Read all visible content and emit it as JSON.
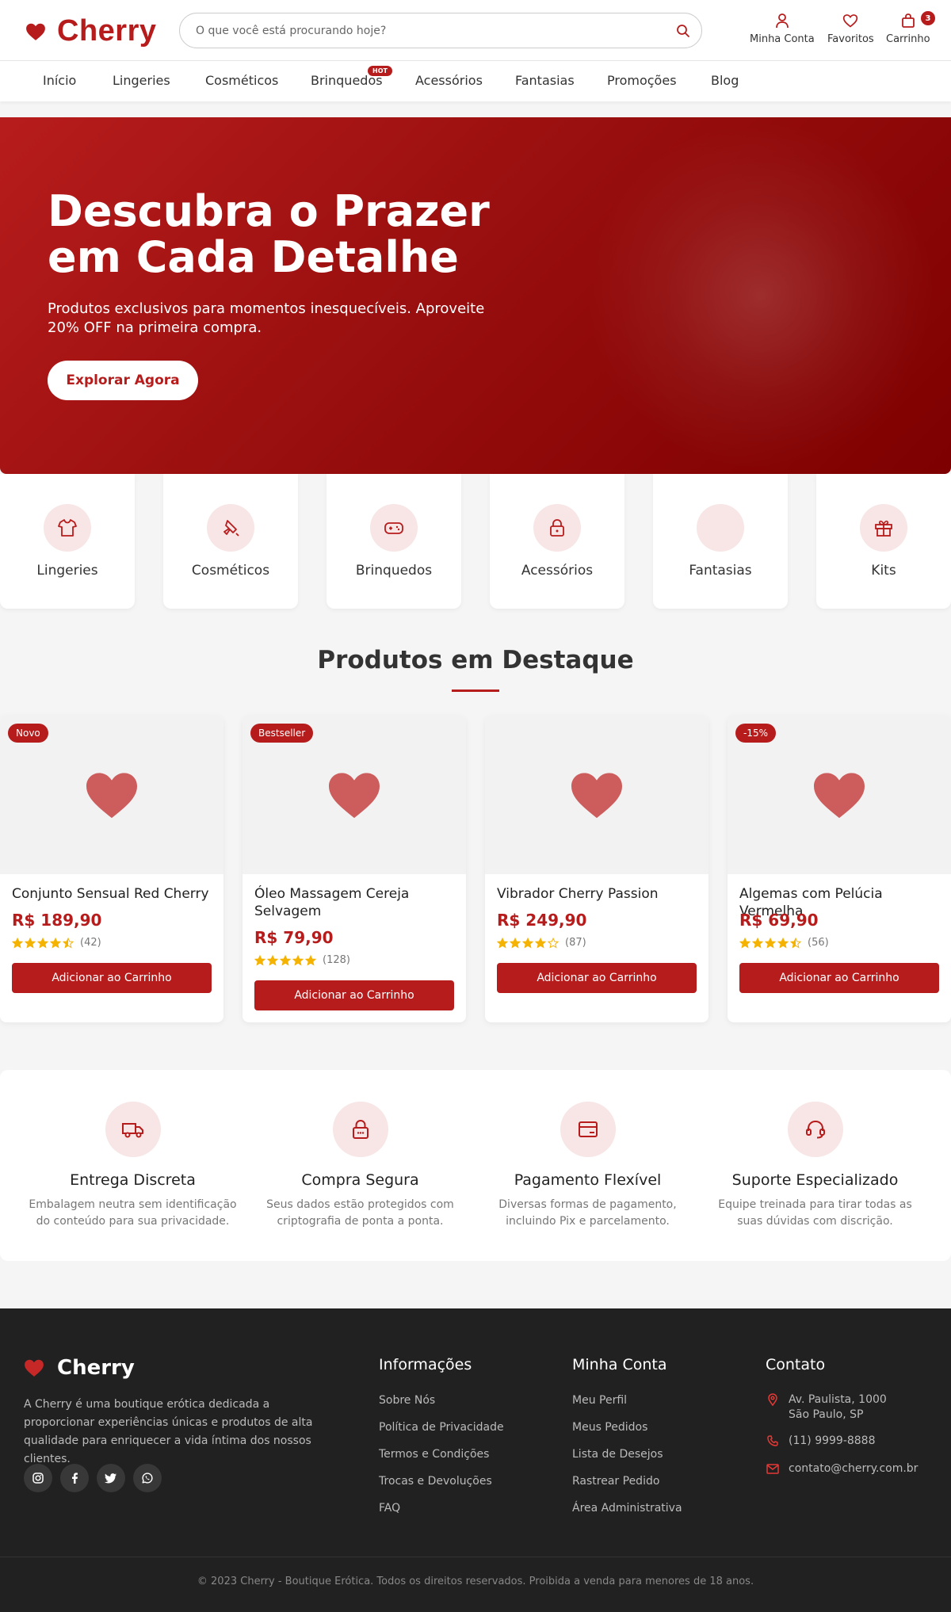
{
  "header": {
    "logo": "Cherry",
    "search_placeholder": "O que você está procurando hoje?",
    "account_label": "Minha Conta",
    "favorites_label": "Favoritos",
    "cart_label": "Carrinho",
    "cart_count": "3"
  },
  "nav": {
    "items": [
      "Início",
      "Lingeries",
      "Cosméticos",
      "Brinquedos",
      "Acessórios",
      "Fantasias",
      "Promoções",
      "Blog"
    ],
    "hot_badge": "HOT"
  },
  "hero": {
    "title": "Descubra o Prazer em Cada Detalhe",
    "subtitle": "Produtos exclusivos para momentos inesquecíveis. Aproveite 20% OFF na primeira compra.",
    "button": "Explorar Agora"
  },
  "categories": [
    {
      "name": "Lingeries",
      "icon": "shirt-icon"
    },
    {
      "name": "Cosméticos",
      "icon": "spray-icon"
    },
    {
      "name": "Brinquedos",
      "icon": "gamepad-icon"
    },
    {
      "name": "Acessórios",
      "icon": "lock-icon"
    },
    {
      "name": "Fantasias",
      "icon": ""
    },
    {
      "name": "Kits",
      "icon": "gift-icon"
    }
  ],
  "featured": {
    "title": "Produtos em Destaque",
    "products": [
      {
        "badge": "Novo",
        "name": "Conjunto Sensual Red Cherry",
        "price": "R$ 189,90",
        "rating": 4.5,
        "reviews": "(42)",
        "button": "Adicionar ao Carrinho"
      },
      {
        "badge": "Bestseller",
        "name": "Óleo Massagem Cereja Selvagem",
        "price": "R$ 79,90",
        "rating": 5,
        "reviews": "(128)",
        "button": "Adicionar ao Carrinho"
      },
      {
        "badge": "",
        "name": "Vibrador Cherry Passion",
        "price": "R$ 249,90",
        "rating": 4,
        "reviews": "(87)",
        "button": "Adicionar ao Carrinho"
      },
      {
        "badge": "-15%",
        "name": "Algemas com Pelúcia Vermelha",
        "price": "R$ 69,90",
        "rating": 4.5,
        "reviews": "(56)",
        "button": "Adicionar ao Carrinho"
      }
    ]
  },
  "features": [
    {
      "title": "Entrega Discreta",
      "desc": "Embalagem neutra sem identificação do conteúdo para sua privacidade.",
      "icon": "truck-icon"
    },
    {
      "title": "Compra Segura",
      "desc": "Seus dados estão protegidos com criptografia de ponta a ponta.",
      "icon": "lock-icon"
    },
    {
      "title": "Pagamento Flexível",
      "desc": "Diversas formas de pagamento, incluindo Pix e parcelamento.",
      "icon": "credit-card-icon"
    },
    {
      "title": "Suporte Especializado",
      "desc": "Equipe treinada para tirar todas as suas dúvidas com discrição.",
      "icon": "headset-icon"
    }
  ],
  "footer": {
    "logo": "Cherry",
    "about": "A Cherry é uma boutique erótica dedicada a proporcionar experiências únicas e produtos de alta qualidade para enriquecer a vida íntima dos nossos clientes.",
    "info_title": "Informações",
    "info_links": [
      "Sobre Nós",
      "Política de Privacidade",
      "Termos e Condições",
      "Trocas e Devoluções",
      "FAQ"
    ],
    "account_title": "Minha Conta",
    "account_links": [
      "Meu Perfil",
      "Meus Pedidos",
      "Lista de Desejos",
      "Rastrear Pedido",
      "Área Administrativa"
    ],
    "contact_title": "Contato",
    "address": "Av. Paulista, 1000\nSão Paulo, SP",
    "phone": "(11) 9999-8888",
    "email": "contato@cherry.com.br",
    "copyright": "© 2023 Cherry - Boutique Erótica. Todos os direitos reservados. Proibida a venda para menores de 18 anos.",
    "social": [
      "instagram-icon",
      "facebook-icon",
      "twitter-icon",
      "whatsapp-icon"
    ]
  },
  "colors": {
    "brand": "#b71c1c",
    "hero_dark": "#7e0000",
    "footer_bg": "#212121",
    "star": "#f5b301"
  }
}
